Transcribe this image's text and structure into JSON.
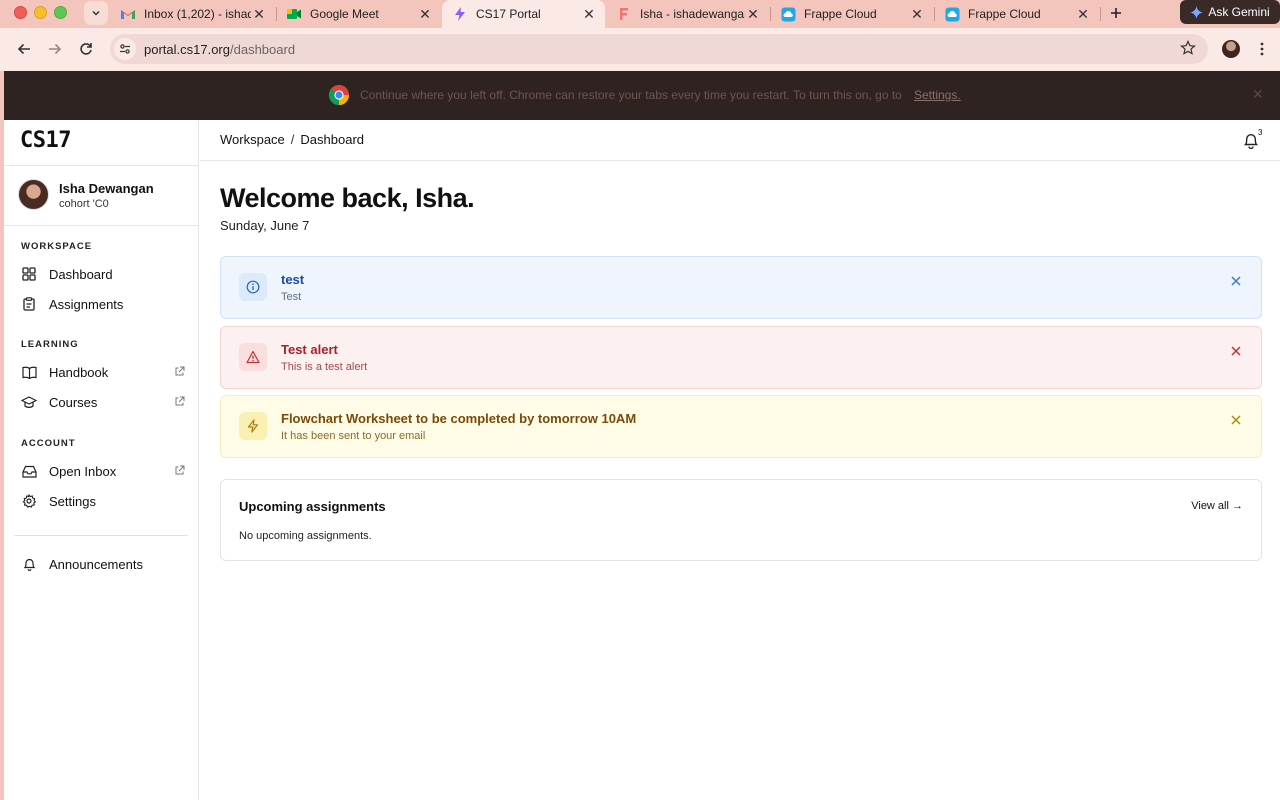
{
  "browser": {
    "tabs": [
      {
        "label": "Inbox (1,202) - ishad",
        "icon": "gmail-icon"
      },
      {
        "label": "Google Meet",
        "icon": "google-meet-icon"
      },
      {
        "label": "CS17 Portal",
        "icon": "cs17-portal-icon"
      },
      {
        "label": "Isha - ishadewangan",
        "icon": "frappe-icon"
      },
      {
        "label": "Frappe Cloud",
        "icon": "frappe-cloud-icon"
      },
      {
        "label": "Frappe Cloud",
        "icon": "frappe-cloud-icon"
      }
    ],
    "active_tab_index": 2,
    "gemini_label": "Ask Gemini",
    "url": {
      "host": "portal.cs17.org",
      "path": "/dashboard"
    },
    "infobar": {
      "text": "Continue where you left off. Chrome can restore your tabs every time you restart. To turn this on, go to",
      "link": "Settings."
    }
  },
  "sidebar": {
    "brand": "CS17",
    "user": {
      "name": "Isha Dewangan",
      "cohort": "cohort 'C0"
    },
    "sections": [
      {
        "label": "WORKSPACE",
        "items": [
          {
            "label": "Dashboard",
            "icon": "dashboard-icon",
            "external": false
          },
          {
            "label": "Assignments",
            "icon": "clipboard-icon",
            "external": false
          }
        ]
      },
      {
        "label": "LEARNING",
        "items": [
          {
            "label": "Handbook",
            "icon": "book-icon",
            "external": true
          },
          {
            "label": "Courses",
            "icon": "graduation-cap-icon",
            "external": true
          }
        ]
      },
      {
        "label": "ACCOUNT",
        "items": [
          {
            "label": "Open Inbox",
            "icon": "inbox-icon",
            "external": true
          },
          {
            "label": "Settings",
            "icon": "gear-icon",
            "external": false
          }
        ]
      }
    ],
    "footer_item": {
      "label": "Announcements",
      "icon": "bell-icon"
    }
  },
  "header": {
    "breadcrumb": [
      "Workspace",
      "Dashboard"
    ],
    "separator": "/",
    "notification_count": "3"
  },
  "main": {
    "greeting": "Welcome back, Isha.",
    "date": "Sunday, June 7",
    "alerts": [
      {
        "type": "info",
        "title": "test",
        "body": "Test",
        "icon": "info-icon"
      },
      {
        "type": "danger",
        "title": "Test alert",
        "body": "This is a test alert",
        "icon": "warning-triangle-icon"
      },
      {
        "type": "warning",
        "title": "Flowchart Worksheet to be completed by tomorrow 10AM",
        "body": "It has been sent to your email",
        "icon": "lightning-icon"
      }
    ],
    "upcoming": {
      "title": "Upcoming assignments",
      "view_all": "View all →",
      "empty": "No upcoming assignments."
    }
  },
  "colors": {
    "tabstrip": "#f3c5bc",
    "info_bg": "#eef5fd",
    "danger_bg": "#fdf0f0",
    "warning_bg": "#fefbe6",
    "info_accent": "#1d4ba3",
    "danger_accent": "#a8222a",
    "warning_accent": "#7a4a07"
  }
}
